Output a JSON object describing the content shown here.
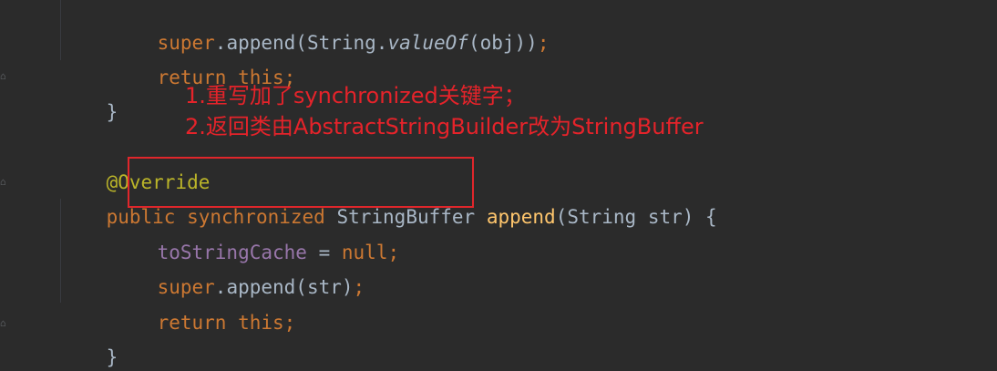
{
  "code": {
    "line1": {
      "kw1": "super",
      "t1": ".append(String.",
      "t2": "valueOf",
      "t3": "(obj))",
      "t4": ";"
    },
    "line2": {
      "kw1": "return",
      "t1": " ",
      "kw2": "this",
      "t2": ";"
    },
    "line3": {
      "t1": "}"
    },
    "line4": {
      "anno": "@Override"
    },
    "line5": {
      "kw1": "public",
      "t1": " ",
      "kw2": "synchronized",
      "t2": " StringBuffer ",
      "method": "append",
      "t3": "(String str) {"
    },
    "line6": {
      "field": "toStringCache",
      "t1": " = ",
      "kw1": "null",
      "t2": ";"
    },
    "line7": {
      "kw1": "super",
      "t1": ".append(str)",
      "t2": ";"
    },
    "line8": {
      "kw1": "return",
      "t1": " ",
      "kw2": "this",
      "t2": ";"
    },
    "line9": {
      "t1": "}"
    }
  },
  "notes": {
    "line1": "1.重写加了synchronized关键字；",
    "line2": "2.返回类由AbstractStringBuilder改为StringBuffer"
  },
  "colors": {
    "background": "#2b2b2b",
    "keyword": "#cc7832",
    "plain": "#a9b7c6",
    "field": "#9876aa",
    "annotation": "#bbb529",
    "method": "#ffc66d",
    "highlight_red": "#e0262b"
  }
}
